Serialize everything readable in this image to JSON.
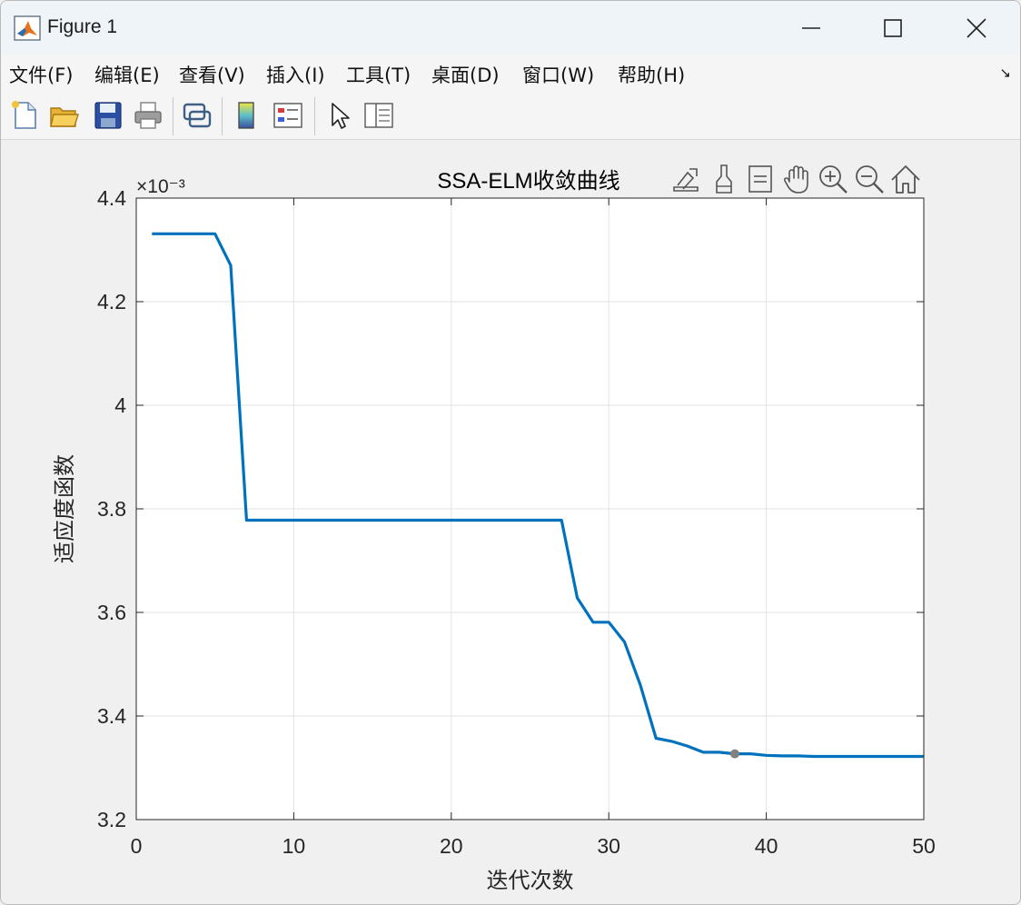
{
  "window": {
    "title": "Figure 1",
    "icon": "matlab-logo-icon"
  },
  "menu": {
    "items": [
      "文件(F)",
      "编辑(E)",
      "查看(V)",
      "插入(I)",
      "工具(T)",
      "桌面(D)",
      "窗口(W)",
      "帮助(H)"
    ],
    "overflow_icon": "dock-arrow-icon"
  },
  "toolbar": {
    "icons": [
      "new-figure-icon",
      "open-file-icon",
      "save-icon",
      "print-icon",
      "link-plot-icon",
      "colorbar-icon",
      "legend-icon",
      "pointer-icon",
      "property-inspector-icon"
    ]
  },
  "axes_toolbar": {
    "icons": [
      "export-icon",
      "brush-icon",
      "data-tips-icon",
      "pan-icon",
      "zoom-in-icon",
      "zoom-out-icon",
      "home-icon"
    ]
  },
  "colors": {
    "line": "#0072bd",
    "marker": "#808080",
    "grid": "#e3e3e3",
    "axes_border": "#262626"
  },
  "chart_data": {
    "type": "line",
    "title": "SSA-ELM收敛曲线",
    "xlabel": "迭代次数",
    "ylabel": "适应度函数",
    "exponent_label": "×10⁻³",
    "xlim": [
      0,
      50
    ],
    "ylim": [
      3.2,
      4.4
    ],
    "xticks": [
      "0",
      "10",
      "20",
      "30",
      "40",
      "50"
    ],
    "yticks": [
      "3.2",
      "3.4",
      "3.6",
      "3.8",
      "4",
      "4.2",
      "4.4"
    ],
    "grid": true,
    "series": [
      {
        "x": [
          1,
          2,
          3,
          4,
          5,
          6,
          7,
          8,
          9,
          10,
          11,
          12,
          13,
          14,
          15,
          16,
          17,
          18,
          19,
          20,
          21,
          22,
          23,
          24,
          25,
          26,
          27,
          28,
          29,
          30,
          31,
          32,
          33,
          34,
          35,
          36,
          37,
          38,
          39,
          40,
          41,
          42,
          43,
          44,
          45,
          46,
          47,
          48,
          49,
          50
        ],
        "y": [
          4.331,
          4.331,
          4.331,
          4.331,
          4.331,
          4.27,
          3.778,
          3.778,
          3.778,
          3.778,
          3.778,
          3.778,
          3.778,
          3.778,
          3.778,
          3.778,
          3.778,
          3.778,
          3.778,
          3.778,
          3.778,
          3.778,
          3.778,
          3.778,
          3.778,
          3.778,
          3.778,
          3.628,
          3.581,
          3.581,
          3.543,
          3.46,
          3.357,
          3.351,
          3.342,
          3.33,
          3.33,
          3.327,
          3.327,
          3.324,
          3.323,
          3.323,
          3.322,
          3.322,
          3.322,
          3.322,
          3.322,
          3.322,
          3.322,
          3.322
        ]
      }
    ],
    "highlight_point": {
      "x": 38,
      "y": 3.327
    }
  }
}
